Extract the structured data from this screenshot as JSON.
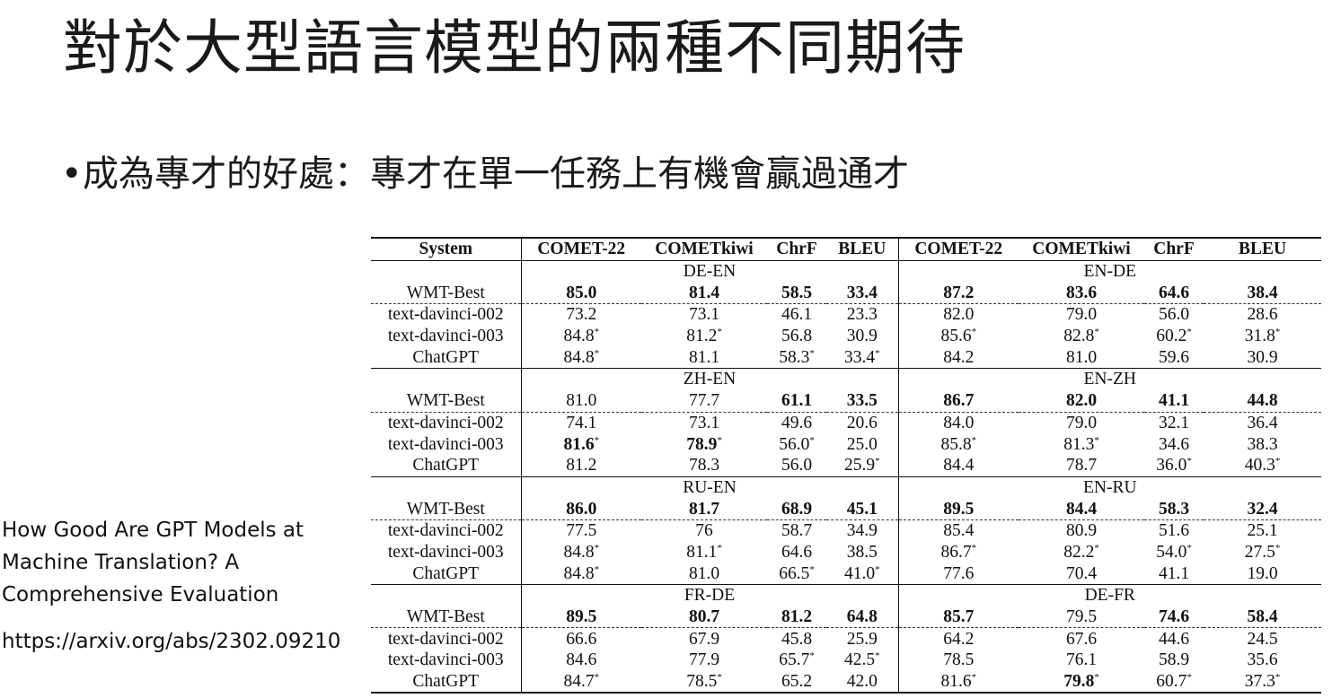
{
  "title": "對於大型語言模型的兩種不同期待",
  "bullet": "成為專才的好處：專才在單一任務上有機會贏過通才",
  "reference": {
    "paper_title": "How Good Are GPT Models at Machine Translation? A Comprehensive Evaluation",
    "url": "https://arxiv.org/abs/2302.09210"
  },
  "table": {
    "headers": [
      "System",
      "COMET-22",
      "COMETkiwi",
      "ChrF",
      "BLEU",
      "COMET-22",
      "COMETkiwi",
      "ChrF",
      "BLEU"
    ],
    "groups": [
      {
        "left_pair": "DE-EN",
        "right_pair": "EN-DE",
        "rows": [
          {
            "system": "WMT-Best",
            "cells": [
              [
                "85.0",
                true,
                false
              ],
              [
                "81.4",
                true,
                false
              ],
              [
                "58.5",
                true,
                false
              ],
              [
                "33.4",
                true,
                false
              ],
              [
                "87.2",
                true,
                false
              ],
              [
                "83.6",
                true,
                false
              ],
              [
                "64.6",
                true,
                false
              ],
              [
                "38.4",
                true,
                false
              ]
            ]
          },
          {
            "system": "text-davinci-002",
            "cells": [
              [
                "73.2",
                false,
                false
              ],
              [
                "73.1",
                false,
                false
              ],
              [
                "46.1",
                false,
                false
              ],
              [
                "23.3",
                false,
                false
              ],
              [
                "82.0",
                false,
                false
              ],
              [
                "79.0",
                false,
                false
              ],
              [
                "56.0",
                false,
                false
              ],
              [
                "28.6",
                false,
                false
              ]
            ]
          },
          {
            "system": "text-davinci-003",
            "cells": [
              [
                "84.8",
                false,
                true
              ],
              [
                "81.2",
                false,
                true
              ],
              [
                "56.8",
                false,
                false
              ],
              [
                "30.9",
                false,
                false
              ],
              [
                "85.6",
                false,
                true
              ],
              [
                "82.8",
                false,
                true
              ],
              [
                "60.2",
                false,
                true
              ],
              [
                "31.8",
                false,
                true
              ]
            ]
          },
          {
            "system": "ChatGPT",
            "cells": [
              [
                "84.8",
                false,
                true
              ],
              [
                "81.1",
                false,
                false
              ],
              [
                "58.3",
                false,
                true
              ],
              [
                "33.4",
                false,
                true
              ],
              [
                "84.2",
                false,
                false
              ],
              [
                "81.0",
                false,
                false
              ],
              [
                "59.6",
                false,
                false
              ],
              [
                "30.9",
                false,
                false
              ]
            ]
          }
        ]
      },
      {
        "left_pair": "ZH-EN",
        "right_pair": "EN-ZH",
        "rows": [
          {
            "system": "WMT-Best",
            "cells": [
              [
                "81.0",
                false,
                false
              ],
              [
                "77.7",
                false,
                false
              ],
              [
                "61.1",
                true,
                false
              ],
              [
                "33.5",
                true,
                false
              ],
              [
                "86.7",
                true,
                false
              ],
              [
                "82.0",
                true,
                false
              ],
              [
                "41.1",
                true,
                false
              ],
              [
                "44.8",
                true,
                false
              ]
            ]
          },
          {
            "system": "text-davinci-002",
            "cells": [
              [
                "74.1",
                false,
                false
              ],
              [
                "73.1",
                false,
                false
              ],
              [
                "49.6",
                false,
                false
              ],
              [
                "20.6",
                false,
                false
              ],
              [
                "84.0",
                false,
                false
              ],
              [
                "79.0",
                false,
                false
              ],
              [
                "32.1",
                false,
                false
              ],
              [
                "36.4",
                false,
                false
              ]
            ]
          },
          {
            "system": "text-davinci-003",
            "cells": [
              [
                "81.6",
                true,
                true
              ],
              [
                "78.9",
                true,
                true
              ],
              [
                "56.0",
                false,
                true
              ],
              [
                "25.0",
                false,
                false
              ],
              [
                "85.8",
                false,
                true
              ],
              [
                "81.3",
                false,
                true
              ],
              [
                "34.6",
                false,
                false
              ],
              [
                "38.3",
                false,
                false
              ]
            ]
          },
          {
            "system": "ChatGPT",
            "cells": [
              [
                "81.2",
                false,
                false
              ],
              [
                "78.3",
                false,
                false
              ],
              [
                "56.0",
                false,
                false
              ],
              [
                "25.9",
                false,
                true
              ],
              [
                "84.4",
                false,
                false
              ],
              [
                "78.7",
                false,
                false
              ],
              [
                "36.0",
                false,
                true
              ],
              [
                "40.3",
                false,
                true
              ]
            ]
          }
        ]
      },
      {
        "left_pair": "RU-EN",
        "right_pair": "EN-RU",
        "rows": [
          {
            "system": "WMT-Best",
            "cells": [
              [
                "86.0",
                true,
                false
              ],
              [
                "81.7",
                true,
                false
              ],
              [
                "68.9",
                true,
                false
              ],
              [
                "45.1",
                true,
                false
              ],
              [
                "89.5",
                true,
                false
              ],
              [
                "84.4",
                true,
                false
              ],
              [
                "58.3",
                true,
                false
              ],
              [
                "32.4",
                true,
                false
              ]
            ]
          },
          {
            "system": "text-davinci-002",
            "cells": [
              [
                "77.5",
                false,
                false
              ],
              [
                "76",
                false,
                false
              ],
              [
                "58.7",
                false,
                false
              ],
              [
                "34.9",
                false,
                false
              ],
              [
                "85.4",
                false,
                false
              ],
              [
                "80.9",
                false,
                false
              ],
              [
                "51.6",
                false,
                false
              ],
              [
                "25.1",
                false,
                false
              ]
            ]
          },
          {
            "system": "text-davinci-003",
            "cells": [
              [
                "84.8",
                false,
                true
              ],
              [
                "81.1",
                false,
                true
              ],
              [
                "64.6",
                false,
                false
              ],
              [
                "38.5",
                false,
                false
              ],
              [
                "86.7",
                false,
                true
              ],
              [
                "82.2",
                false,
                true
              ],
              [
                "54.0",
                false,
                true
              ],
              [
                "27.5",
                false,
                true
              ]
            ]
          },
          {
            "system": "ChatGPT",
            "cells": [
              [
                "84.8",
                false,
                true
              ],
              [
                "81.0",
                false,
                false
              ],
              [
                "66.5",
                false,
                true
              ],
              [
                "41.0",
                false,
                true
              ],
              [
                "77.6",
                false,
                false
              ],
              [
                "70.4",
                false,
                false
              ],
              [
                "41.1",
                false,
                false
              ],
              [
                "19.0",
                false,
                false
              ]
            ]
          }
        ]
      },
      {
        "left_pair": "FR-DE",
        "right_pair": "DE-FR",
        "rows": [
          {
            "system": "WMT-Best",
            "cells": [
              [
                "89.5",
                true,
                false
              ],
              [
                "80.7",
                true,
                false
              ],
              [
                "81.2",
                true,
                false
              ],
              [
                "64.8",
                true,
                false
              ],
              [
                "85.7",
                true,
                false
              ],
              [
                "79.5",
                false,
                false
              ],
              [
                "74.6",
                true,
                false
              ],
              [
                "58.4",
                true,
                false
              ]
            ]
          },
          {
            "system": "text-davinci-002",
            "cells": [
              [
                "66.6",
                false,
                false
              ],
              [
                "67.9",
                false,
                false
              ],
              [
                "45.8",
                false,
                false
              ],
              [
                "25.9",
                false,
                false
              ],
              [
                "64.2",
                false,
                false
              ],
              [
                "67.6",
                false,
                false
              ],
              [
                "44.6",
                false,
                false
              ],
              [
                "24.5",
                false,
                false
              ]
            ]
          },
          {
            "system": "text-davinci-003",
            "cells": [
              [
                "84.6",
                false,
                false
              ],
              [
                "77.9",
                false,
                false
              ],
              [
                "65.7",
                false,
                true
              ],
              [
                "42.5",
                false,
                true
              ],
              [
                "78.5",
                false,
                false
              ],
              [
                "76.1",
                false,
                false
              ],
              [
                "58.9",
                false,
                false
              ],
              [
                "35.6",
                false,
                false
              ]
            ]
          },
          {
            "system": "ChatGPT",
            "cells": [
              [
                "84.7",
                false,
                true
              ],
              [
                "78.5",
                false,
                true
              ],
              [
                "65.2",
                false,
                false
              ],
              [
                "42.0",
                false,
                false
              ],
              [
                "81.6",
                false,
                true
              ],
              [
                "79.8",
                true,
                true
              ],
              [
                "60.7",
                false,
                true
              ],
              [
                "37.3",
                false,
                true
              ]
            ]
          }
        ]
      }
    ]
  }
}
